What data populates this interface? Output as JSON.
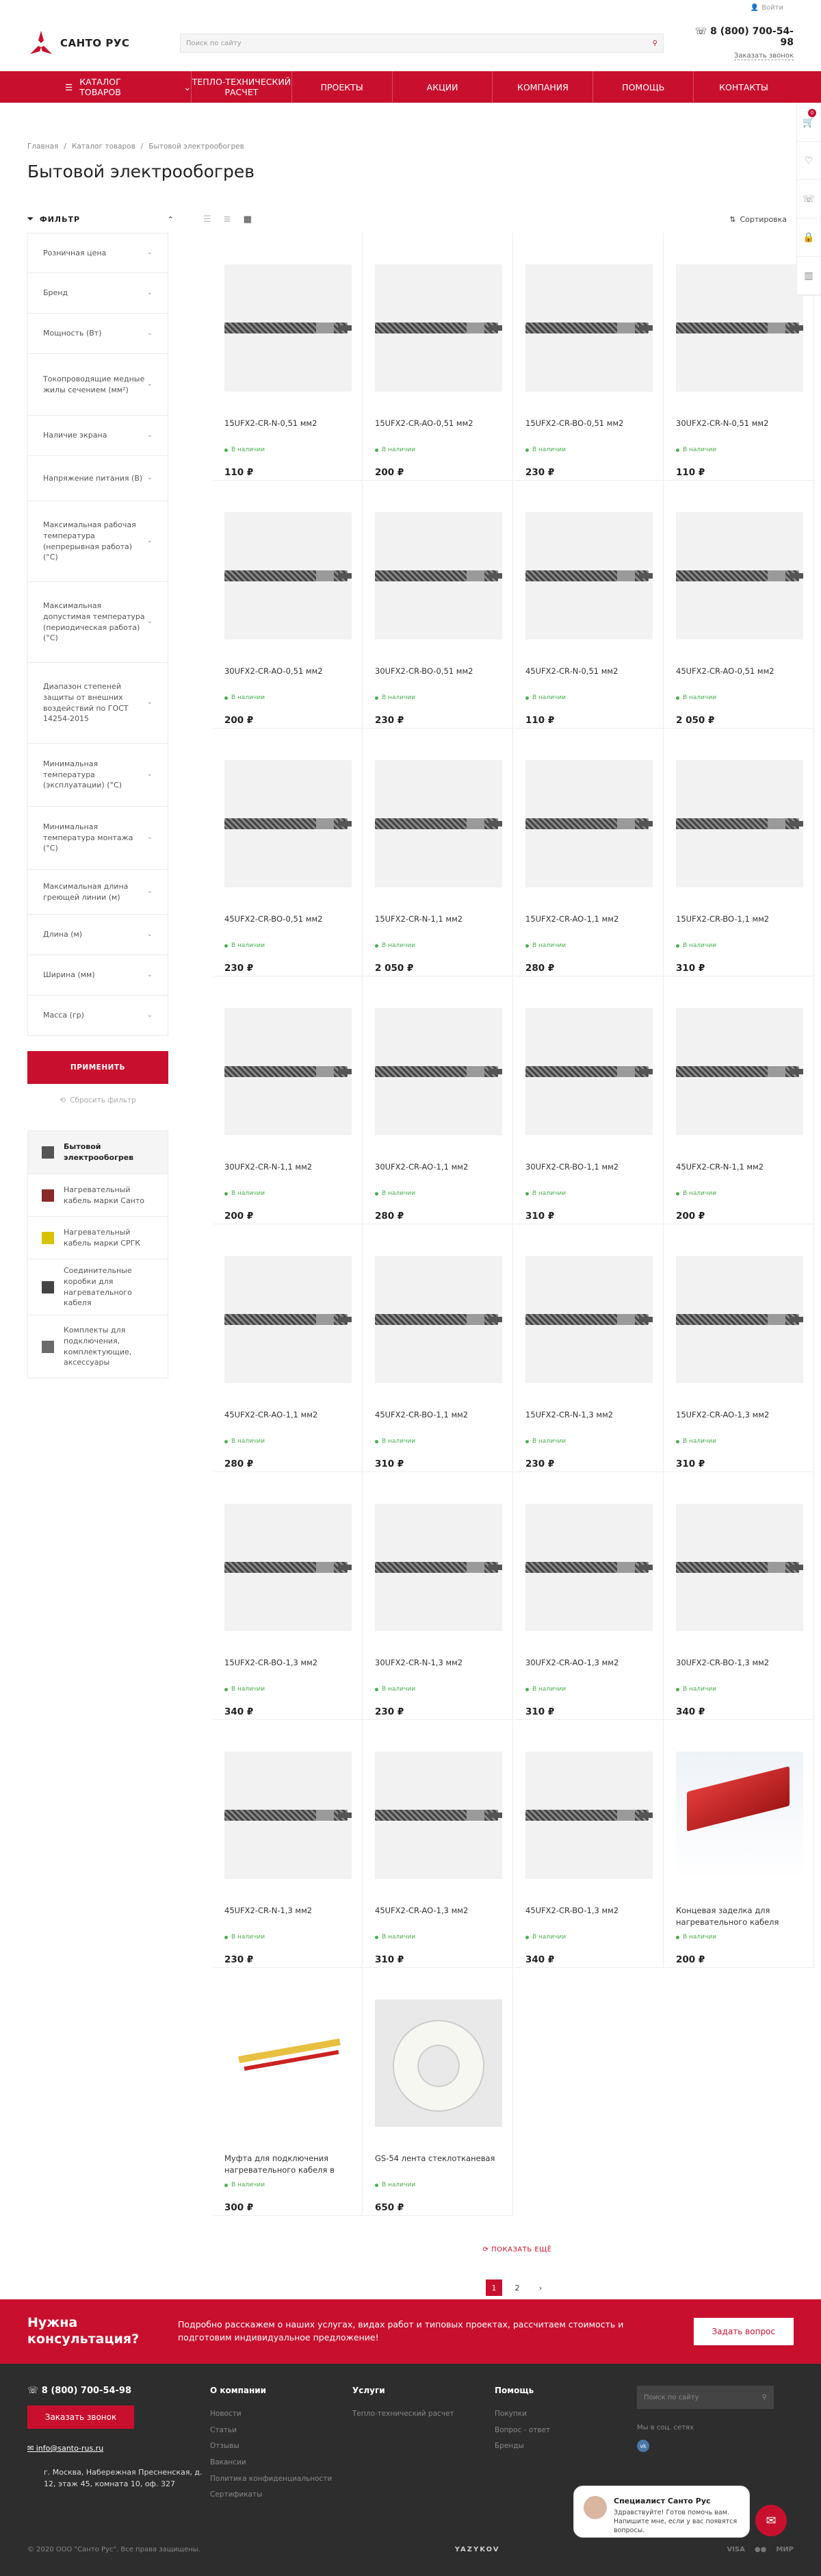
{
  "topbar": {
    "login": "Войти"
  },
  "header": {
    "logo_text": "САНТО РУС",
    "search_placeholder": "Поиск по сайту",
    "phone": "8 (800) 700-54-98",
    "callback": "Заказать звонок"
  },
  "nav": {
    "catalog": "Каталог товаров",
    "items": [
      "Тепло-технический расчет",
      "Проекты",
      "Акции",
      "Компания",
      "Помощь",
      "Контакты"
    ]
  },
  "breadcrumbs": [
    "Главная",
    "Каталог товаров",
    "Бытовой электрообогрев"
  ],
  "page_title": "Бытовой электрообогрев",
  "toolbar": {
    "filter": "ФИЛЬТР",
    "sort": "Сортировка"
  },
  "filters": [
    {
      "label": "Розничная цена",
      "h": 59
    },
    {
      "label": "Бренд",
      "h": 59
    },
    {
      "label": "Мощность (Вт)",
      "h": 59
    },
    {
      "label": "Токопроводящие медные жилы сечением (мм²)",
      "h": 90
    },
    {
      "label": "Наличие экрана",
      "h": 59
    },
    {
      "label": "Напряжение питания (В)",
      "h": 66
    },
    {
      "label": "Максимальная рабочая температура (непрерывная работа) (°C)",
      "h": 118
    },
    {
      "label": "Максимальная допустимая температура (периодическая работа) (°C)",
      "h": 118
    },
    {
      "label": "Диапазон степеней защиты от внешних воздействий по ГОСТ 14254-2015",
      "h": 118
    },
    {
      "label": "Минимальная температура (эксплуатации) (°C)",
      "h": 92
    },
    {
      "label": "Минимальная температура монтажа (°C)",
      "h": 92
    },
    {
      "label": "Максимальная длина греющей линии (м)",
      "h": 66
    },
    {
      "label": "Длина (м)",
      "h": 59
    },
    {
      "label": "Ширина (мм)",
      "h": 59
    },
    {
      "label": "Масса (гр)",
      "h": 59
    }
  ],
  "filter_actions": {
    "apply": "Применить",
    "reset": "Сбросить фильтр"
  },
  "subcategories": [
    {
      "label": "Бытовой электрообогрев",
      "h": 62
    },
    {
      "label": "Нагревательный кабель марки Санто",
      "h": 62
    },
    {
      "label": "Нагревательный кабель марки СРГК",
      "h": 62
    },
    {
      "label": "Соединительные коробки для нагревательного кабеля",
      "h": 82
    },
    {
      "label": "Комплекты для подключения, комплектующие, аксессуары",
      "h": 92
    }
  ],
  "stock_label": "В наличии",
  "products": [
    {
      "name": "15UFX2-CR-N-0,51 мм2",
      "price": "110 ₽",
      "img": "cable"
    },
    {
      "name": "15UFX2-CR-AO-0,51 мм2",
      "price": "200 ₽",
      "img": "cable"
    },
    {
      "name": "15UFX2-CR-BO-0,51 мм2",
      "price": "230 ₽",
      "img": "cable"
    },
    {
      "name": "30UFX2-CR-N-0,51 мм2",
      "price": "110 ₽",
      "img": "cable"
    },
    {
      "name": "30UFX2-CR-AO-0,51 мм2",
      "price": "200 ₽",
      "img": "cable"
    },
    {
      "name": "30UFX2-CR-BO-0,51 мм2",
      "price": "230 ₽",
      "img": "cable"
    },
    {
      "name": "45UFX2-CR-N-0,51 мм2",
      "price": "110 ₽",
      "img": "cable"
    },
    {
      "name": "45UFX2-CR-AO-0,51 мм2",
      "price": "2 050 ₽",
      "img": "cable"
    },
    {
      "name": "45UFX2-CR-BO-0,51 мм2",
      "price": "230 ₽",
      "img": "cable"
    },
    {
      "name": "15UFX2-CR-N-1,1 мм2",
      "price": "2 050 ₽",
      "img": "cable"
    },
    {
      "name": "15UFX2-CR-AO-1,1 мм2",
      "price": "280 ₽",
      "img": "cable"
    },
    {
      "name": "15UFX2-CR-BO-1,1 мм2",
      "price": "310 ₽",
      "img": "cable"
    },
    {
      "name": "30UFX2-CR-N-1,1 мм2",
      "price": "200 ₽",
      "img": "cable"
    },
    {
      "name": "30UFX2-CR-AO-1,1 мм2",
      "price": "280 ₽",
      "img": "cable"
    },
    {
      "name": "30UFX2-CR-BO-1,1 мм2",
      "price": "310 ₽",
      "img": "cable"
    },
    {
      "name": "45UFX2-CR-N-1,1 мм2",
      "price": "200 ₽",
      "img": "cable"
    },
    {
      "name": "45UFX2-CR-AO-1,1 мм2",
      "price": "280 ₽",
      "img": "cable"
    },
    {
      "name": "45UFX2-CR-BO-1,1 мм2",
      "price": "310 ₽",
      "img": "cable"
    },
    {
      "name": "15UFX2-CR-N-1,3 мм2",
      "price": "230 ₽",
      "img": "cable"
    },
    {
      "name": "15UFX2-CR-AO-1,3 мм2",
      "price": "310 ₽",
      "img": "cable"
    },
    {
      "name": "15UFX2-CR-BO-1,3 мм2",
      "price": "340 ₽",
      "img": "cable"
    },
    {
      "name": "30UFX2-CR-N-1,3 мм2",
      "price": "230 ₽",
      "img": "cable"
    },
    {
      "name": "30UFX2-CR-AO-1,3 мм2",
      "price": "310 ₽",
      "img": "cable"
    },
    {
      "name": "30UFX2-CR-BO-1,3 мм2",
      "price": "340 ₽",
      "img": "cable"
    },
    {
      "name": "45UFX2-CR-N-1,3 мм2",
      "price": "230 ₽",
      "img": "cable"
    },
    {
      "name": "45UFX2-CR-AO-1,3 мм2",
      "price": "310 ₽",
      "img": "cable"
    },
    {
      "name": "45UFX2-CR-BO-1,3 мм2",
      "price": "340 ₽",
      "img": "cable"
    },
    {
      "name": "Концевая заделка для нагревательного кабеля",
      "price": "200 ₽",
      "img": "endcap"
    },
    {
      "name": "Муфта для подключения нагревательного кабеля в",
      "price": "300 ₽",
      "img": "muf"
    },
    {
      "name": "GS-54 лента стеклотканевая",
      "price": "650 ₽",
      "img": "tape"
    }
  ],
  "pagination": {
    "more": "Показать ещё",
    "pages": [
      "1",
      "2"
    ],
    "next": "›"
  },
  "consult": {
    "title": "Нужна консультация?",
    "text": "Подробно расскажем о наших услугах, видах работ и типовых проектах, рассчитаем стоимость и подготовим индивидуальное предложение!",
    "button": "Задать вопрос"
  },
  "footer": {
    "phone": "8 (800) 700-54-98",
    "callback": "Заказать звонок",
    "email": "info@santo-rus.ru",
    "address": "г. Москва, Набережная Пресненская, д. 12, этаж 45, комната 10, оф. 327",
    "col1": {
      "title": "О компании",
      "links": [
        "Новости",
        "Статьи",
        "Отзывы",
        "Вакансии",
        "Политика конфиденциальности",
        "Сертификаты"
      ]
    },
    "col2": {
      "title": "Услуги",
      "links": [
        "Тепло-технический расчет"
      ]
    },
    "col3": {
      "title": "Помощь",
      "links": [
        "Покупки",
        "Вопрос - ответ",
        "Бренды"
      ]
    },
    "search_placeholder": "Поиск по сайту",
    "social": "Мы в соц. сетях",
    "vk": "vk",
    "copyright": "© 2020 ООО \"Санто Рус\". Все права защищены.",
    "brand": "YAZYKOV",
    "pay": [
      "VISA",
      "●●",
      "МИР"
    ]
  },
  "chat": {
    "name": "Специалист Санто Рус",
    "text": "Здравствуйте! Готов помочь вам. Напишите мне, если у вас появятся вопросы."
  },
  "cart_count": "0"
}
